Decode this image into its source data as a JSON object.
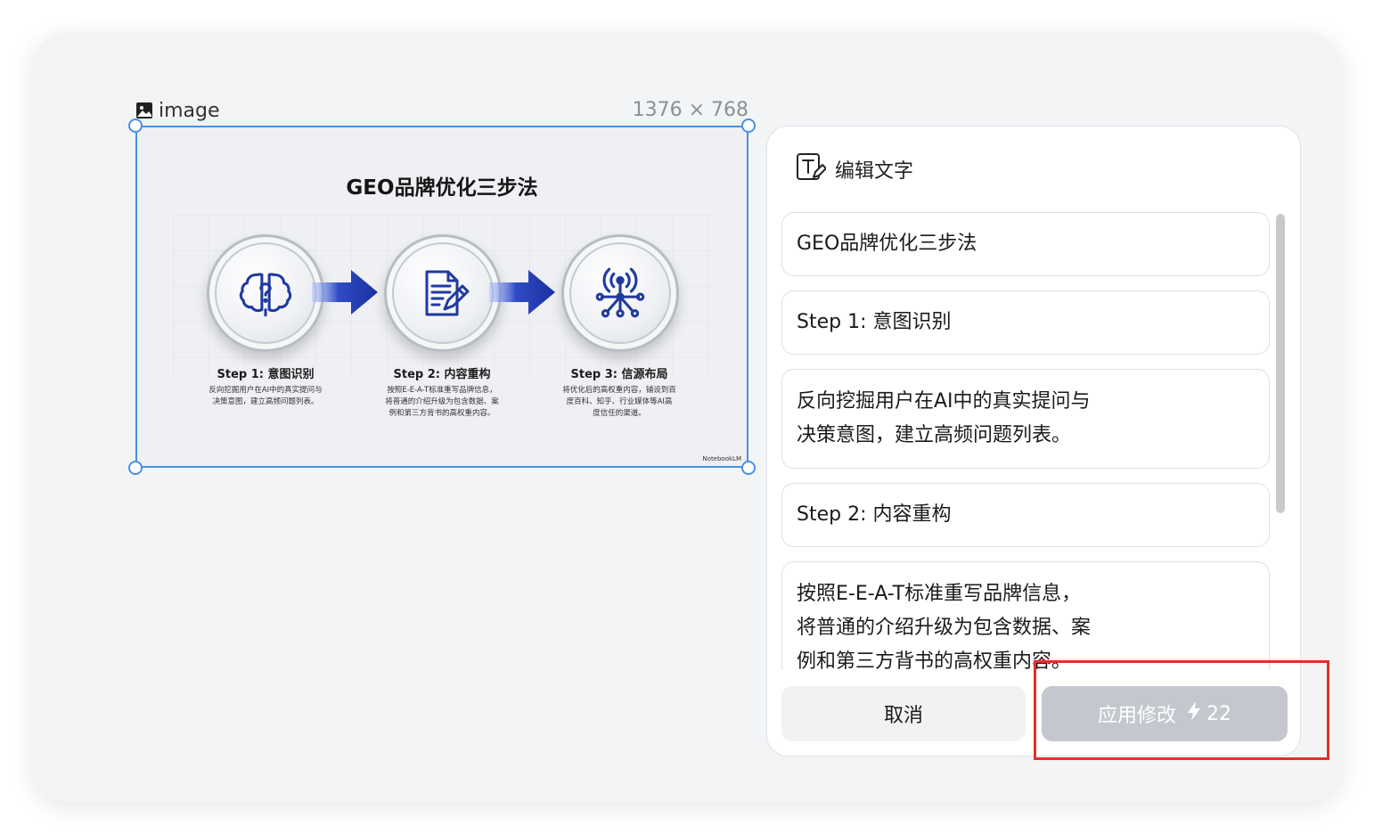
{
  "canvas": {
    "image_label": "image",
    "image_size": "1376 × 768",
    "slide": {
      "title": "GEO品牌优化三步法",
      "steps": [
        {
          "title": "Step 1:  意图识别",
          "desc": "反向挖掘用户在AI中的真实提问与\n决策意图，建立高频问题列表。",
          "icon": "brain-question-icon"
        },
        {
          "title": "Step 2:  内容重构",
          "desc": "按照E-E-A-T标准重写品牌信息，\n将普通的介绍升级为包含数据、案\n例和第三方背书的高权重内容。",
          "icon": "document-pen-icon"
        },
        {
          "title": "Step 3:  信源布局",
          "desc": "将优化后的高权重内容，铺设到百\n度百科、知乎、行业媒体等AI高\n度信任的渠道。",
          "icon": "network-signal-icon"
        }
      ],
      "brand": "NotebookLM"
    }
  },
  "panel": {
    "title": "编辑文字",
    "fields": [
      "GEO品牌优化三步法",
      "Step 1: 意图识别",
      "反向挖掘用户在AI中的真实提问与\n决策意图，建立高频问题列表。",
      "Step 2: 内容重构",
      "按照E-E-A-T标准重写品牌信息，\n将普通的介绍升级为包含数据、案\n例和第三方背书的高权重内容。"
    ],
    "cancel_label": "取消",
    "apply_label": "应用修改",
    "apply_cost": "22"
  },
  "colors": {
    "selection": "#4a90e2",
    "accent_icon": "#1f3a9e",
    "apply_disabled": "#c4c8ce",
    "highlight": "#e0302a"
  }
}
